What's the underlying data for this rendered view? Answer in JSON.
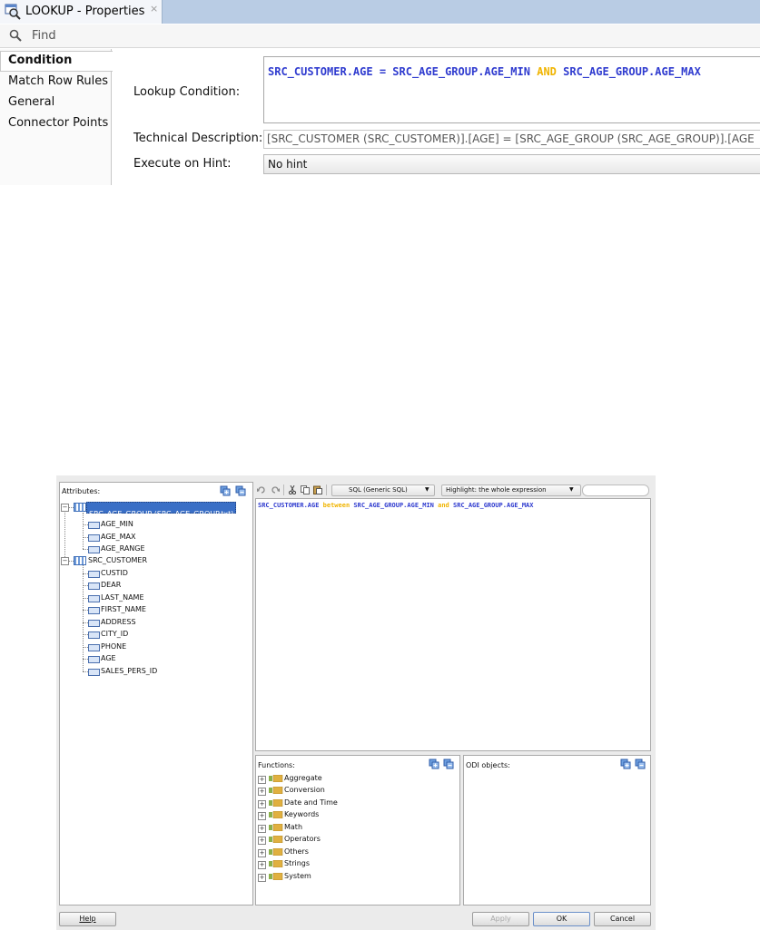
{
  "properties": {
    "tab_title": "LOOKUP - Properties",
    "close_glyph": "×",
    "find_placeholder": "Find",
    "nav": [
      "Condition",
      "Match Row Rules",
      "General",
      "Connector Points"
    ],
    "labels": {
      "lookup_condition": "Lookup Condition:",
      "technical_description": "Technical Description:",
      "execute_on_hint": "Execute on Hint:"
    },
    "lookup_condition": {
      "part1": "SRC_CUSTOMER.AGE = SRC_AGE_GROUP.AGE_MIN ",
      "kw": "AND",
      "part2": " SRC_AGE_GROUP.AGE_MAX"
    },
    "technical_description": "[SRC_CUSTOMER (SRC_CUSTOMER)].[AGE] = [SRC_AGE_GROUP (SRC_AGE_GROUP)].[AGE",
    "execute_on_hint": "No hint"
  },
  "editor": {
    "attributes_title": "Attributes:",
    "tree": [
      {
        "name": "SRC_AGE_GROUP (SRC_AGE_GROUP.txt)",
        "children": [
          "AGE_MIN",
          "AGE_MAX",
          "AGE_RANGE"
        ]
      },
      {
        "name": "SRC_CUSTOMER",
        "children": [
          "CUSTID",
          "DEAR",
          "LAST_NAME",
          "FIRST_NAME",
          "ADDRESS",
          "CITY_ID",
          "PHONE",
          "AGE",
          "SALES_PERS_ID"
        ]
      }
    ],
    "language_combo": "SQL (Generic SQL)",
    "highlight_combo": "Highlight: the whole expression",
    "expression": {
      "p1": "SRC_CUSTOMER.AGE ",
      "kw1": "between",
      "p2": " SRC_AGE_GROUP.AGE_MIN ",
      "kw2": "and",
      "p3": " SRC_AGE_GROUP.AGE_MAX"
    },
    "functions_title": "Functions:",
    "functions": [
      "Aggregate",
      "Conversion",
      "Date and Time",
      "Keywords",
      "Math",
      "Operators",
      "Others",
      "Strings",
      "System"
    ],
    "odi_title": "ODI objects:",
    "buttons": {
      "help": "Help",
      "apply": "Apply",
      "ok": "OK",
      "cancel": "Cancel"
    }
  },
  "colors": {
    "keyword": "#f0b400",
    "identifier": "#2f3bcf",
    "selection": "#3a6fc6",
    "tabbar": "#b9cce4"
  }
}
